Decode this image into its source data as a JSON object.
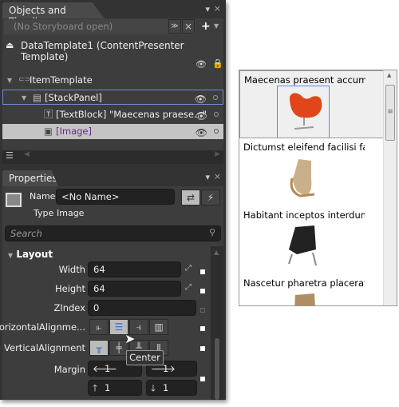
{
  "objects_panel": {
    "title": "Objects and Timeline",
    "storyboard": "(No Storyboard open)",
    "template": "DataTemplate1 (ContentPresenter Template)",
    "tree": [
      {
        "label": "ItemTemplate"
      },
      {
        "label": "[StackPanel]"
      },
      {
        "label": "[TextBlock] \"Maecenas praese...\""
      },
      {
        "label": "[Image]"
      }
    ]
  },
  "properties_panel": {
    "title": "Properties",
    "name_label": "Name",
    "name_value": "<No Name>",
    "type_label": "Type",
    "type_value": "Image",
    "search_placeholder": "Search",
    "section": "Layout",
    "width_label": "Width",
    "width": "64",
    "height_label": "Height",
    "height": "64",
    "zindex_label": "ZIndex",
    "zindex": "0",
    "halign_label": "HorizontalAlignme...",
    "valign_label": "VerticalAlignment",
    "margin_label": "Margin",
    "margin": {
      "left": "1",
      "right": "1",
      "top": "1",
      "bottom": "1"
    },
    "tooltip": "Center"
  },
  "listbox": {
    "items": [
      {
        "text": "Maecenas praesent accumsan",
        "color": "#e0461a"
      },
      {
        "text": "Dictumst eleifend facilisi faucibus",
        "color": "#c9a777"
      },
      {
        "text": "Habitant inceptos interdum lobortis",
        "color": "#222222"
      },
      {
        "text": "Nascetur pharetra placerat pulvinar",
        "color": "#b08e63"
      }
    ]
  }
}
